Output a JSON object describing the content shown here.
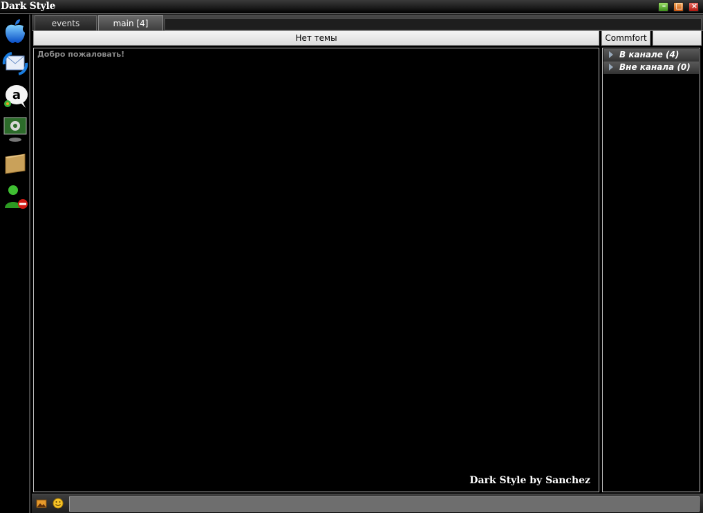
{
  "window": {
    "title": "Dark Style"
  },
  "tabs": [
    {
      "label": "events"
    },
    {
      "label": "main [4]"
    }
  ],
  "topic": {
    "text": "Нет темы"
  },
  "chat": {
    "welcome": "Добро пожаловать!",
    "signature": "Dark Style by Sanchez"
  },
  "channel": {
    "name": "Commfort"
  },
  "user_groups": [
    {
      "label": "В канале  (4)"
    },
    {
      "label": "Вне канала  (0)"
    }
  ],
  "sidebar_icons": [
    "apple-icon",
    "mail-sync-icon",
    "chat-bubble-icon",
    "monitor-settings-icon",
    "folder-icon",
    "user-remove-icon"
  ],
  "bottom_icons": [
    "image-icon",
    "smiley-icon"
  ],
  "colors": {
    "background": "#000000",
    "topic_bar": "#e8e8e8",
    "minimize": "#5fb832",
    "maximize": "#e07a25",
    "close": "#d32a1e"
  }
}
